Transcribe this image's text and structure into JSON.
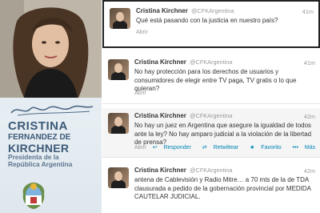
{
  "profile": {
    "name_first": "CRISTINA",
    "name_middle": "FERNANDEZ DE",
    "name_last": "KIRCHNER",
    "role_line1": "Presidenta de la",
    "role_line2": "República Argentina"
  },
  "tweets": [
    {
      "author": "Cristina Kirchner",
      "handle": "@CFKArgentina",
      "time": "41m",
      "text": "Qué está pasando con la justicia en nuestro país?",
      "open_label": "Abrir"
    },
    {
      "author": "Cristina Kirchner",
      "handle": "@CFKArgentina",
      "time": "41m",
      "text": "No hay protección para los derechos de usuarios y consumidores de elegir entre TV paga, TV gratis o lo que quieran?",
      "open_label": "Abrir"
    },
    {
      "author": "Cristina Kirchner",
      "handle": "@CFKArgentina",
      "time": "42m",
      "text": "No hay un juez en Argentina que asegure la igualdad de todos ante la ley? No hay amparo judicial a la violación de la libertad de prensa?",
      "actions": {
        "open": "Abrir",
        "reply": "Responder",
        "retweet": "Retwittear",
        "favorite": "Favorito",
        "more": "Más"
      }
    },
    {
      "author": "Cristina Kirchner",
      "handle": "@CFKArgentina",
      "time": "42m",
      "text": "antena de Cablevisión y Radio Mitre… a 70 mts de la de TDA clausurada a pedido de la gobernación provincial por MEDIDA CAUTELAR JUDICIAL."
    }
  ]
}
